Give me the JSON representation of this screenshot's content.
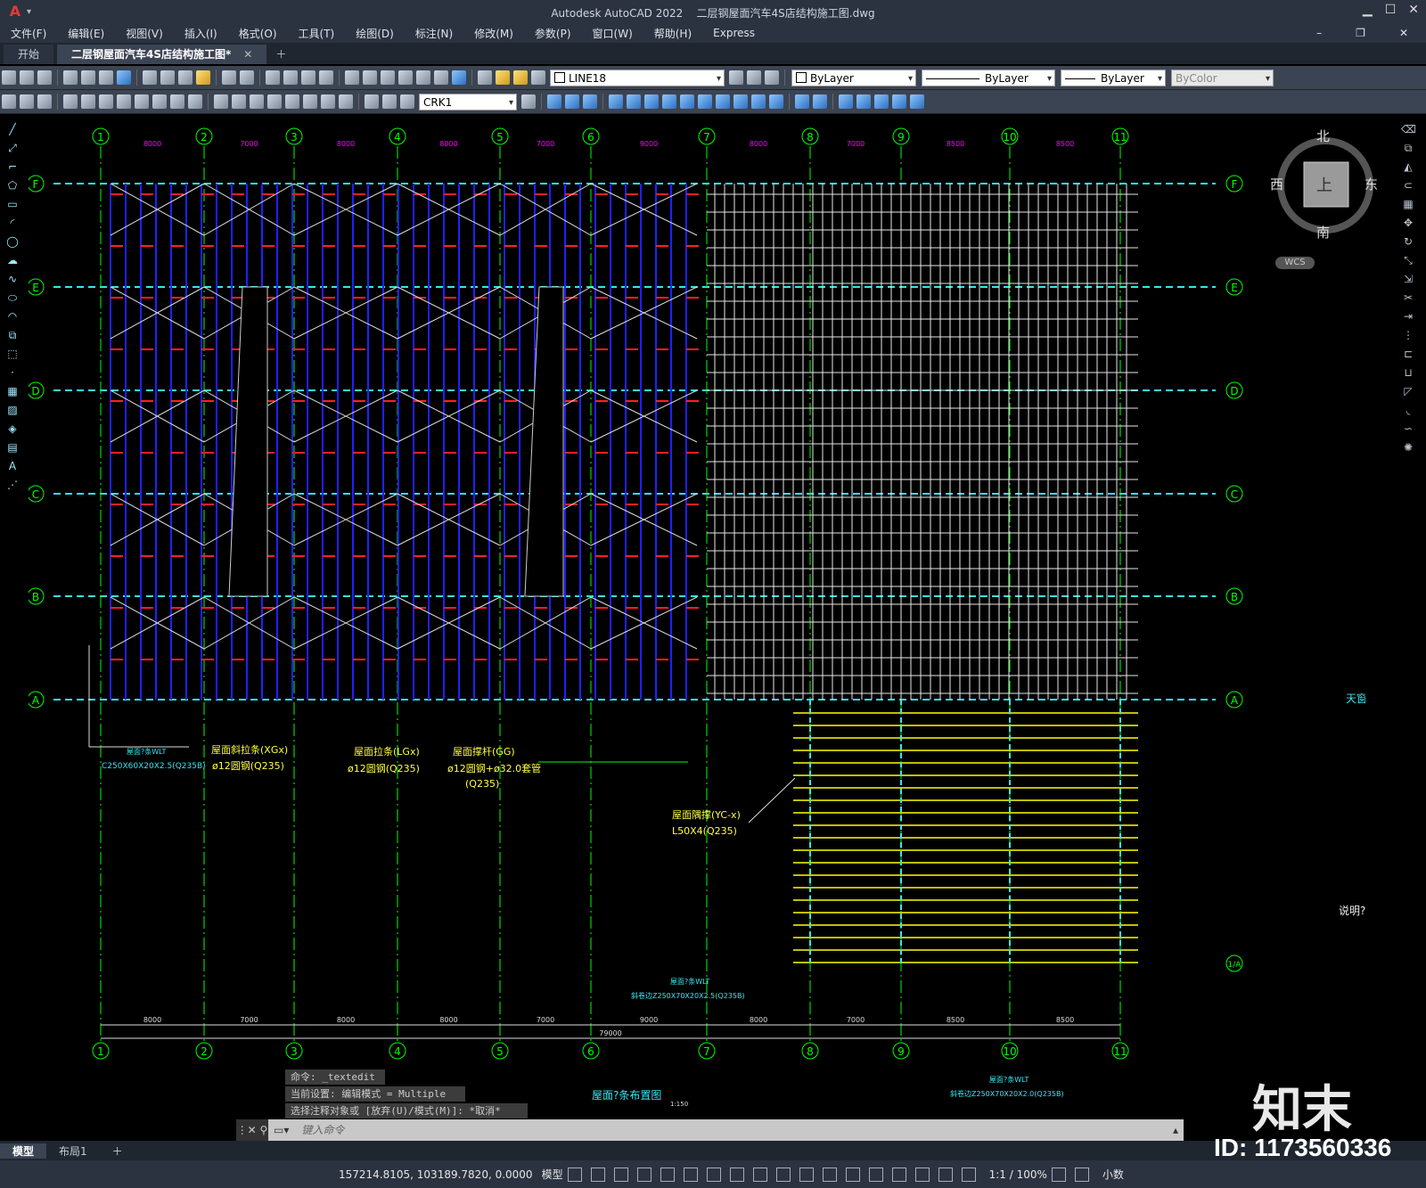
{
  "titlebar": {
    "app": "Autodesk AutoCAD 2022",
    "file": "二层钢屋面汽车4S店结构施工图.dwg"
  },
  "menu": [
    "文件(F)",
    "编辑(E)",
    "视图(V)",
    "插入(I)",
    "格式(O)",
    "工具(T)",
    "绘图(D)",
    "标注(N)",
    "修改(M)",
    "参数(P)",
    "窗口(W)",
    "帮助(H)",
    "Express"
  ],
  "tabs": [
    {
      "label": "开始"
    },
    {
      "label": "二层钢屋面汽车4S店结构施工图*"
    }
  ],
  "toolbar": {
    "layer": "LINE18",
    "color": "ByLayer",
    "linetype": "ByLayer",
    "lineweight": "ByLayer",
    "plotstyle": "ByColor",
    "dimstyle": "CRK1"
  },
  "compass": {
    "north": "北",
    "south": "南",
    "west": "西",
    "east": "东",
    "top": "上",
    "wcs": "WCS"
  },
  "grid": {
    "columns": [
      "1",
      "2",
      "3",
      "4",
      "5",
      "6",
      "7",
      "8",
      "9",
      "10",
      "11"
    ],
    "rows_left": [
      "F",
      "E",
      "D",
      "C",
      "B",
      "A"
    ],
    "top_dims": [
      "8000",
      "7000",
      "8000",
      "8000",
      "7000",
      "9000",
      "8000",
      "7000",
      "8500",
      "8500"
    ],
    "bottom_dims": [
      "8000",
      "7000",
      "8000",
      "8000",
      "7000",
      "9000",
      "8000",
      "7000",
      "8500",
      "8500"
    ],
    "total": "79000",
    "extra_row": "1/A"
  },
  "labels": {
    "purlin_wlt": "屋面?条WLT",
    "purlin_wlt_spec": "C250X60X20X2.5(Q235B)",
    "xg": "屋面斜拉条(XGx)",
    "xg_spec": "ø12圆钢(Q235)",
    "lg": "屋面拉条(LGx)",
    "lg_spec": "ø12圆钢(Q235)",
    "gg": "屋面撑杆(GG)",
    "gg_spec": "ø12圆钢+ø32.0套管",
    "gg_spec2": "(Q235)",
    "yc": "屋面隅撑(YC-x)",
    "yc_spec": "L50X4(Q235)",
    "wlt_b": "屋面?条WLT",
    "wlt_b_spec": "斜卷边Z250X70X20X2.5(Q235B)",
    "wlt_c": "屋面?条WLT",
    "wlt_c_spec": "斜卷边Z250X70X20X2.0(Q235B)",
    "plan_title": "屋面?条布置图",
    "scale": "1:150",
    "note": "说明?",
    "skylight": "天窗"
  },
  "command": {
    "line1": "命令: _textedit",
    "line2": "当前设置: 编辑模式 = Multiple",
    "line3": "选择注释对象或 [放弃(U)/模式(M)]: *取消*",
    "placeholder": "键入命令"
  },
  "layout_tabs": [
    "模型",
    "布局1"
  ],
  "status": {
    "coords": "157214.8105, 103189.7820, 0.0000",
    "space": "模型",
    "scale": "1:1 / 100%",
    "units": "小数"
  },
  "watermark": {
    "logo": "知末",
    "id": "ID: 1173560336"
  },
  "colors": {
    "bg": "#000000",
    "grid": "#35e6f0",
    "purlin": "#2020ff",
    "tie": "#ff2020",
    "green": "#00ff00",
    "yellow": "#ffff00",
    "magenta": "#ff00ff",
    "label": "#ffff40"
  }
}
